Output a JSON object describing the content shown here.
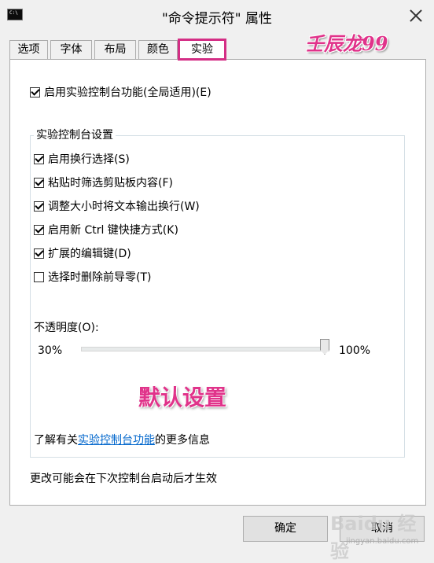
{
  "window": {
    "title": "\"命令提示符\" 属性"
  },
  "watermarks": {
    "top": "壬辰龙99",
    "middle": "默认设置",
    "baidu": "Baidu 经验",
    "baidu_sub": "jingyan.baidu.com"
  },
  "tabs": [
    {
      "label": "选项",
      "active": false
    },
    {
      "label": "字体",
      "active": false
    },
    {
      "label": "布局",
      "active": false
    },
    {
      "label": "颜色",
      "active": false
    },
    {
      "label": "实验",
      "active": true
    }
  ],
  "global_option": {
    "label": "启用实验控制台功能(全局适用)(E)",
    "checked": true
  },
  "group": {
    "title": "实验控制台设置",
    "options": [
      {
        "label": "启用换行选择(S)",
        "checked": true
      },
      {
        "label": "粘贴时筛选剪贴板内容(F)",
        "checked": true
      },
      {
        "label": "调整大小时将文本输出换行(W)",
        "checked": true
      },
      {
        "label": "启用新 Ctrl 键快捷方式(K)",
        "checked": true
      },
      {
        "label": "扩展的编辑键(D)",
        "checked": true
      },
      {
        "label": "选择时删除前导零(T)",
        "checked": false
      }
    ],
    "opacity": {
      "label": "不透明度(O):",
      "min_label": "30%",
      "max_label": "100%",
      "value_percent": 100
    },
    "info": {
      "prefix": "了解有关",
      "link": "实验控制台功能",
      "suffix": "的更多信息"
    }
  },
  "notice": "更改可能会在下次控制台启动后才生效",
  "buttons": {
    "ok": "确定",
    "cancel": "取消"
  },
  "colors": {
    "highlight": "#d42e85",
    "link": "#0066cc"
  }
}
